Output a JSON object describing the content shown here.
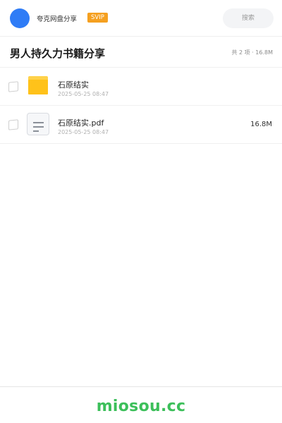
{
  "header": {
    "app_name": "夸克网盘分享",
    "badge": "SVIP",
    "search_placeholder": "搜索",
    "avatar_color": "#2f7cf6",
    "badge_color": "#f5a020"
  },
  "share": {
    "title": "男人持久力书籍分享",
    "summary": "共 2 项 · 16.8M"
  },
  "files": [
    {
      "type": "folder",
      "icon": "folder-icon",
      "name": "石原结实",
      "date": "2025-05-25 08:47",
      "size": ""
    },
    {
      "type": "pdf",
      "icon": "document-icon",
      "name": "石原结实.pdf",
      "date": "2025-05-25 08:47",
      "size": "16.8M"
    }
  ],
  "footer": {
    "brand": "miosou.cc",
    "brand_color": "#3cbf5a"
  }
}
